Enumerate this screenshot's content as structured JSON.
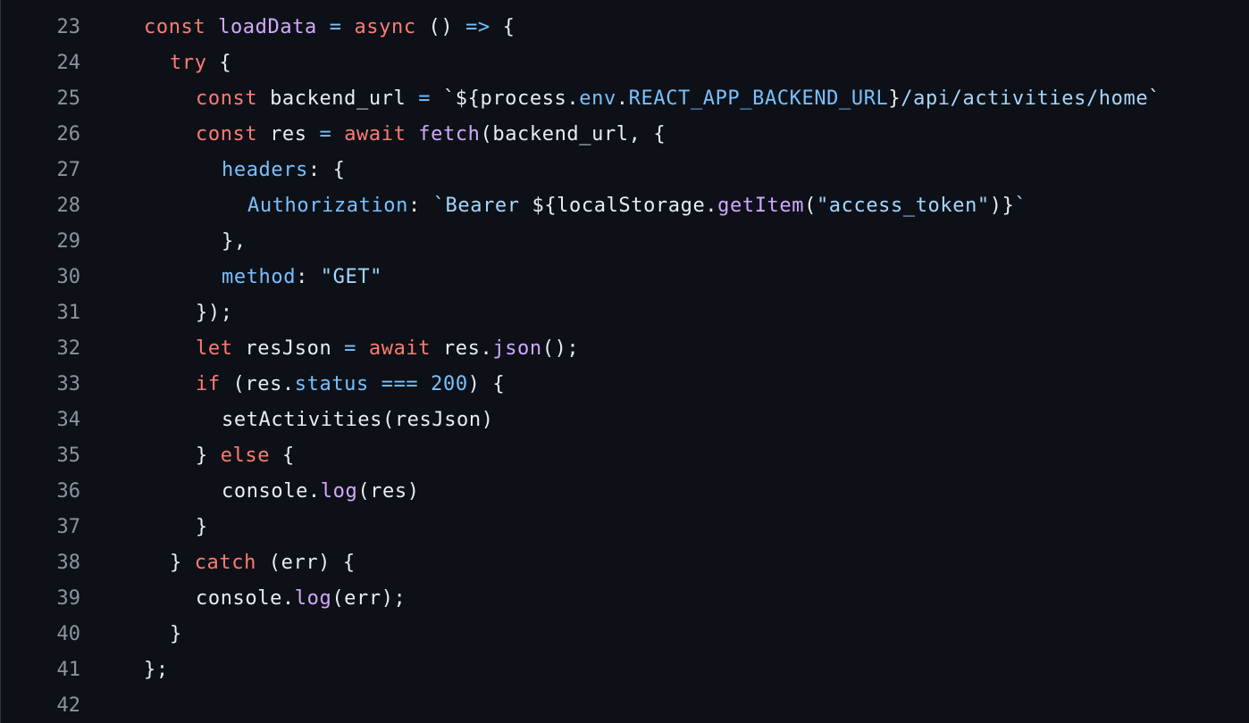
{
  "colors": {
    "background": "#0d1117",
    "line_number": "#8b949e",
    "keyword": "#ff7b72",
    "function": "#d2a8ff",
    "property": "#79c0ff",
    "string": "#a5d6ff",
    "plain": "#e6edf3"
  },
  "lines": [
    {
      "number": "23",
      "indent": 0,
      "tokens": [
        {
          "t": "kw",
          "v": "const"
        },
        {
          "t": "plain",
          "v": " "
        },
        {
          "t": "fn",
          "v": "loadData"
        },
        {
          "t": "plain",
          "v": " "
        },
        {
          "t": "prop",
          "v": "="
        },
        {
          "t": "plain",
          "v": " "
        },
        {
          "t": "kw",
          "v": "async"
        },
        {
          "t": "plain",
          "v": " () "
        },
        {
          "t": "prop",
          "v": "=>"
        },
        {
          "t": "plain",
          "v": " {"
        }
      ]
    },
    {
      "number": "24",
      "indent": 1,
      "tokens": [
        {
          "t": "kw",
          "v": "try"
        },
        {
          "t": "plain",
          "v": " {"
        }
      ]
    },
    {
      "number": "25",
      "indent": 2,
      "tokens": [
        {
          "t": "kw",
          "v": "const"
        },
        {
          "t": "plain",
          "v": " backend_url "
        },
        {
          "t": "prop",
          "v": "="
        },
        {
          "t": "plain",
          "v": " `${process."
        },
        {
          "t": "prop",
          "v": "env"
        },
        {
          "t": "plain",
          "v": "."
        },
        {
          "t": "prop",
          "v": "REACT_APP_BACKEND_URL"
        },
        {
          "t": "plain",
          "v": "}"
        },
        {
          "t": "str",
          "v": "/api/activities/home"
        },
        {
          "t": "plain",
          "v": "`"
        }
      ]
    },
    {
      "number": "26",
      "indent": 2,
      "tokens": [
        {
          "t": "kw",
          "v": "const"
        },
        {
          "t": "plain",
          "v": " res "
        },
        {
          "t": "prop",
          "v": "="
        },
        {
          "t": "plain",
          "v": " "
        },
        {
          "t": "kw",
          "v": "await"
        },
        {
          "t": "plain",
          "v": " "
        },
        {
          "t": "fn",
          "v": "fetch"
        },
        {
          "t": "plain",
          "v": "(backend_url, {"
        }
      ]
    },
    {
      "number": "27",
      "indent": 3,
      "tokens": [
        {
          "t": "prop",
          "v": "headers"
        },
        {
          "t": "plain",
          "v": ": {"
        }
      ]
    },
    {
      "number": "28",
      "indent": 4,
      "tokens": [
        {
          "t": "prop",
          "v": "Authorization"
        },
        {
          "t": "plain",
          "v": ": "
        },
        {
          "t": "str",
          "v": "`Bearer "
        },
        {
          "t": "plain",
          "v": "${localStorage."
        },
        {
          "t": "fn",
          "v": "getItem"
        },
        {
          "t": "plain",
          "v": "("
        },
        {
          "t": "str",
          "v": "\"access_token\""
        },
        {
          "t": "plain",
          "v": ")}"
        },
        {
          "t": "str",
          "v": "`"
        }
      ]
    },
    {
      "number": "29",
      "indent": 3,
      "tokens": [
        {
          "t": "plain",
          "v": "},"
        }
      ]
    },
    {
      "number": "30",
      "indent": 3,
      "tokens": [
        {
          "t": "prop",
          "v": "method"
        },
        {
          "t": "plain",
          "v": ": "
        },
        {
          "t": "str",
          "v": "\"GET\""
        }
      ]
    },
    {
      "number": "31",
      "indent": 2,
      "tokens": [
        {
          "t": "plain",
          "v": "});"
        }
      ]
    },
    {
      "number": "32",
      "indent": 2,
      "tokens": [
        {
          "t": "kw",
          "v": "let"
        },
        {
          "t": "plain",
          "v": " resJson "
        },
        {
          "t": "prop",
          "v": "="
        },
        {
          "t": "plain",
          "v": " "
        },
        {
          "t": "kw",
          "v": "await"
        },
        {
          "t": "plain",
          "v": " res."
        },
        {
          "t": "fn",
          "v": "json"
        },
        {
          "t": "plain",
          "v": "();"
        }
      ]
    },
    {
      "number": "33",
      "indent": 2,
      "tokens": [
        {
          "t": "kw",
          "v": "if"
        },
        {
          "t": "plain",
          "v": " (res."
        },
        {
          "t": "prop",
          "v": "status"
        },
        {
          "t": "plain",
          "v": " "
        },
        {
          "t": "prop",
          "v": "==="
        },
        {
          "t": "plain",
          "v": " "
        },
        {
          "t": "prop",
          "v": "200"
        },
        {
          "t": "plain",
          "v": ") {"
        }
      ]
    },
    {
      "number": "34",
      "indent": 3,
      "tokens": [
        {
          "t": "plain",
          "v": "setActivities(resJson)"
        }
      ]
    },
    {
      "number": "35",
      "indent": 2,
      "tokens": [
        {
          "t": "plain",
          "v": "} "
        },
        {
          "t": "kw",
          "v": "else"
        },
        {
          "t": "plain",
          "v": " {"
        }
      ]
    },
    {
      "number": "36",
      "indent": 3,
      "tokens": [
        {
          "t": "plain",
          "v": "console."
        },
        {
          "t": "fn",
          "v": "log"
        },
        {
          "t": "plain",
          "v": "(res)"
        }
      ]
    },
    {
      "number": "37",
      "indent": 2,
      "tokens": [
        {
          "t": "plain",
          "v": "}"
        }
      ]
    },
    {
      "number": "38",
      "indent": 1,
      "tokens": [
        {
          "t": "plain",
          "v": "} "
        },
        {
          "t": "kw",
          "v": "catch"
        },
        {
          "t": "plain",
          "v": " (err) {"
        }
      ]
    },
    {
      "number": "39",
      "indent": 2,
      "tokens": [
        {
          "t": "plain",
          "v": "console."
        },
        {
          "t": "fn",
          "v": "log"
        },
        {
          "t": "plain",
          "v": "(err);"
        }
      ]
    },
    {
      "number": "40",
      "indent": 1,
      "tokens": [
        {
          "t": "plain",
          "v": "}"
        }
      ]
    },
    {
      "number": "41",
      "indent": 0,
      "tokens": [
        {
          "t": "plain",
          "v": "};"
        }
      ]
    },
    {
      "number": "42",
      "indent": 0,
      "tokens": []
    }
  ]
}
